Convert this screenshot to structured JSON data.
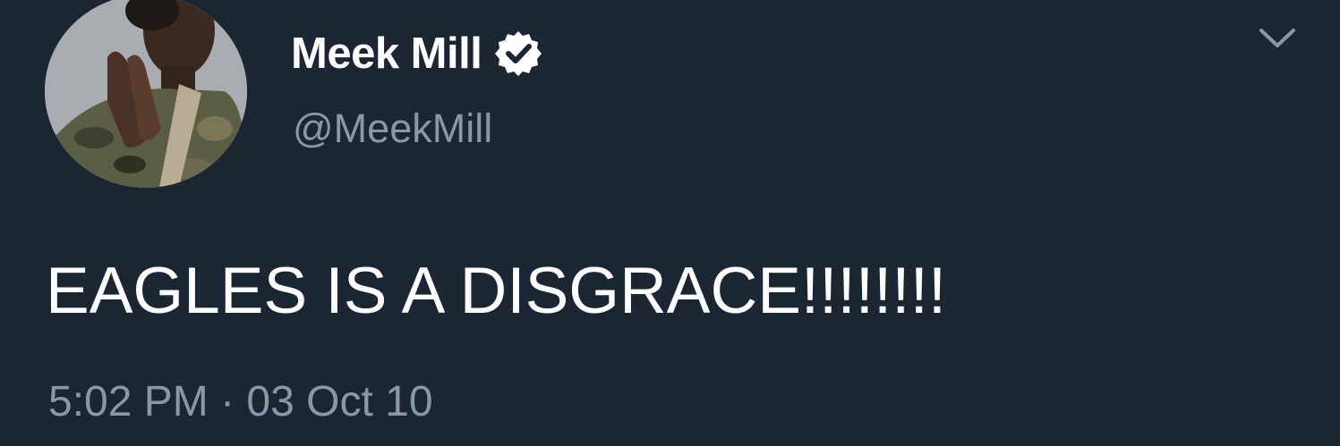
{
  "tweet": {
    "author": {
      "display_name": "Meek Mill",
      "handle": "@MeekMill",
      "verified": true
    },
    "text": "EAGLES IS A DISGRACE!!!!!!!!",
    "timestamp": "5:02 PM · 03 Oct 10"
  },
  "icons": {
    "verified": "verified-badge-icon",
    "menu": "chevron-down-icon"
  },
  "colors": {
    "background": "#1c2532",
    "primary_text": "#ffffff",
    "secondary_text": "#8899a6"
  }
}
